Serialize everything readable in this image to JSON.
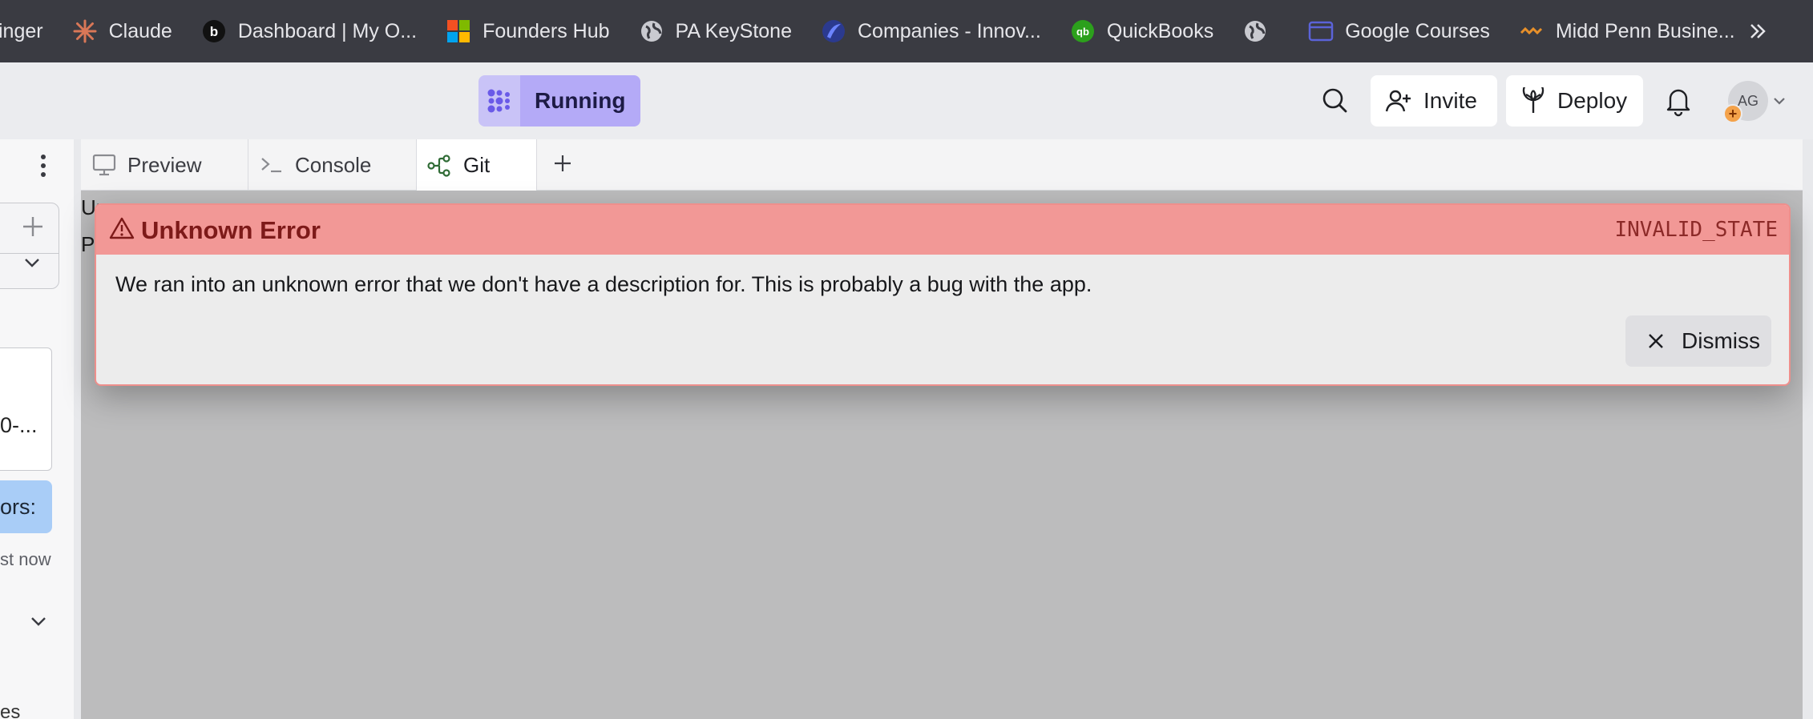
{
  "bookmarks": {
    "items": [
      {
        "label": "inger",
        "icon": "bookmark-icon"
      },
      {
        "label": "Claude",
        "icon": "claude-sunburst-icon"
      },
      {
        "label": "Dashboard | My O...",
        "icon": "b-logo-icon"
      },
      {
        "label": "Founders Hub",
        "icon": "microsoft-icon"
      },
      {
        "label": "PA KeyStone",
        "icon": "globe-icon"
      },
      {
        "label": "Companies - Innov...",
        "icon": "innovate-icon"
      },
      {
        "label": "QuickBooks",
        "icon": "quickbooks-icon"
      },
      {
        "label": "",
        "icon": "globe-icon"
      },
      {
        "label": "Google Courses",
        "icon": "browser-window-icon"
      },
      {
        "label": "Midd Penn Busine...",
        "icon": "midd-penn-icon"
      }
    ],
    "more_label": "»"
  },
  "header": {
    "status_label": "Running",
    "invite_label": "Invite",
    "deploy_label": "Deploy",
    "avatar_initials": "AG",
    "avatar_badge": "+"
  },
  "sidebar": {
    "card_text": "0-...",
    "highlight_text": "ors:",
    "timestamp": "st now",
    "bottom_text": "es"
  },
  "tabs": [
    {
      "label": "Preview",
      "icon": "monitor-icon"
    },
    {
      "label": "Console",
      "icon": "terminal-icon"
    },
    {
      "label": "Git",
      "icon": "git-branch-icon",
      "active": true
    }
  ],
  "background_text": {
    "line1": "Un...",
    "line2": "P"
  },
  "error_dialog": {
    "title": "Unknown Error",
    "code": "INVALID_STATE",
    "message": "We ran into an unknown error that we don't have a description for. This is probably a bug with the app.",
    "dismiss_label": "Dismiss"
  },
  "colors": {
    "bookmarks_bar": "#3a3b42",
    "running_accent": "#b4aaf7",
    "error_header": "#f29896",
    "error_border": "#ee8f8c",
    "error_title": "#7d1a19",
    "git_tab_icon": "#2f6b35"
  }
}
